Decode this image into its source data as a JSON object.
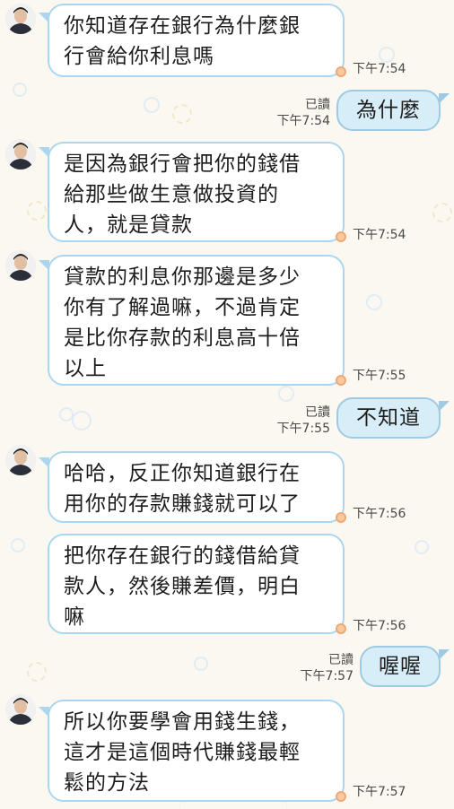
{
  "theme": {
    "bubble_in_border": "#aad7ee",
    "bubble_out_fill": "#d7edf7",
    "background": "#fbf8f2"
  },
  "messages": [
    {
      "side": "in",
      "text": "你知道存在銀行為什麼銀\n行會給你利息嗎",
      "time": "下午7:54"
    },
    {
      "side": "out",
      "text": "為什麼",
      "read": "已讀",
      "time": "下午7:54"
    },
    {
      "side": "in",
      "text": "是因為銀行會把你的錢借\n給那些做生意做投資的\n人，就是貸款",
      "time": "下午7:54"
    },
    {
      "side": "in",
      "text": "貸款的利息你那邊是多少\n你有了解過嘛，不過肯定\n是比你存款的利息高十倍\n以上",
      "time": "下午7:55"
    },
    {
      "side": "out",
      "text": "不知道",
      "read": "已讀",
      "time": "下午7:55"
    },
    {
      "side": "in",
      "text": "哈哈，反正你知道銀行在\n用你的存款賺錢就可以了",
      "time": "下午7:56"
    },
    {
      "side": "in",
      "text": "把你存在銀行的錢借給貸\n款人，然後賺差價，明白\n嘛",
      "time": "下午7:56"
    },
    {
      "side": "out",
      "text": "喔喔",
      "read": "已讀",
      "time": "下午7:57"
    },
    {
      "side": "in",
      "text": "所以你要學會用錢生錢，\n這才是這個時代賺錢最輕\n鬆的方法",
      "time": "下午7:57"
    }
  ]
}
